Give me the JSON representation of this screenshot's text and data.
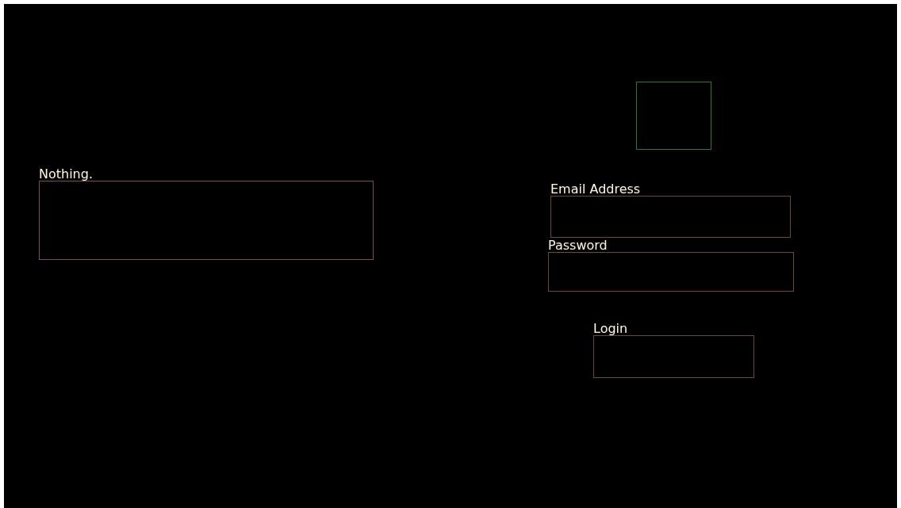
{
  "regions": [
    {
      "label": "Nothing.",
      "color": "#7a4a66"
    },
    {
      "color": "#2e7a2a"
    },
    {
      "label": "Email Address",
      "color": "#6e4838"
    },
    {
      "label": "Password",
      "color": "#6e4838"
    },
    {
      "label": "Login",
      "color": "#6e4838"
    }
  ]
}
